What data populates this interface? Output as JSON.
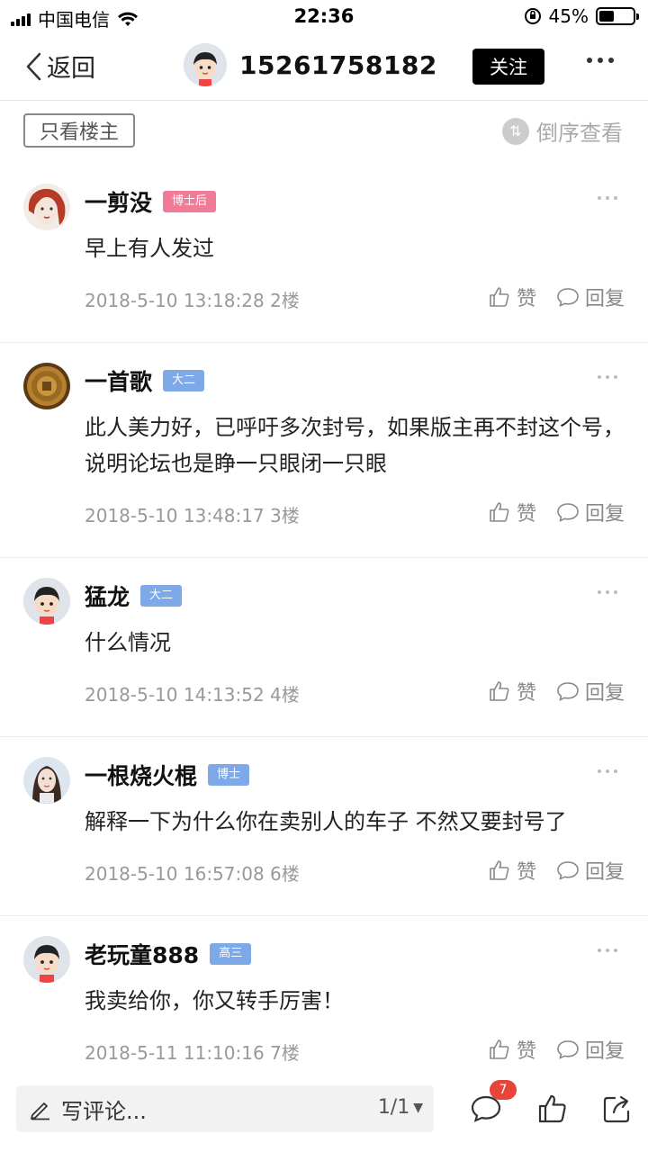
{
  "status_bar": {
    "carrier": "中国电信",
    "time": "22:36",
    "battery": "45%",
    "battery_level": 0.45
  },
  "nav": {
    "back_label": "返回",
    "title": "15261758182",
    "follow_label": "关注"
  },
  "filter": {
    "only_owner_label": "只看楼主",
    "reverse_label": "倒序查看"
  },
  "comments": [
    {
      "name": "一剪没",
      "badge": "博士后",
      "badge_color": "#f07b98",
      "text": "早上有人发过",
      "meta": "2018-5-10 13:18:28  2楼"
    },
    {
      "name": "一首歌",
      "badge": "大二",
      "badge_color": "#7ea9e8",
      "text": "此人美力好，已呼吁多次封号，如果版主再不封这个号，说明论坛也是睁一只眼闭一只眼",
      "meta": "2018-5-10 13:48:17  3楼"
    },
    {
      "name": "猛龙",
      "badge": "大二",
      "badge_color": "#7ea9e8",
      "text": "什么情况",
      "meta": "2018-5-10 14:13:52  4楼"
    },
    {
      "name": "一根烧火棍",
      "badge": "博士",
      "badge_color": "#7ea9e8",
      "text": "解释一下为什么你在卖别人的车子  不然又要封号了",
      "meta": "2018-5-10 16:57:08  6楼"
    },
    {
      "name": "老玩童888",
      "badge": "高三",
      "badge_color": "#7ea9e8",
      "text": "我卖给你，你又转手厉害！",
      "meta": "2018-5-11 11:10:16  7楼"
    }
  ],
  "actions": {
    "like_label": "赞",
    "reply_label": "回复"
  },
  "bottom_bar": {
    "write_placeholder": "写评论...",
    "page_indicator": "1/1",
    "comment_count": "7"
  }
}
